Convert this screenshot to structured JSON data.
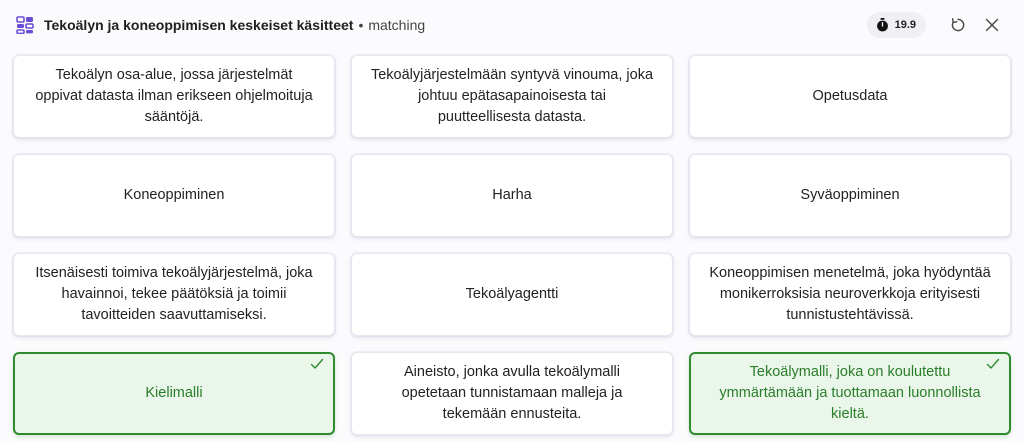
{
  "header": {
    "title": "Tekoälyn ja koneoppimisen keskeiset käsitteet",
    "separator": "•",
    "mode": "matching",
    "timer": "19.9"
  },
  "icons": {
    "app": "app-grid-icon",
    "timer": "stopwatch-icon",
    "restart": "restart-icon",
    "close": "close-icon",
    "check": "checkmark-icon"
  },
  "colors": {
    "matched_border": "#2e8b2e",
    "matched_background": "#eaf6ea",
    "matched_text": "#2a7d2a",
    "app_icon": "#6b4ed8"
  },
  "cards": [
    {
      "text": "Tekoälyn osa-alue, jossa järjestelmät oppivat datasta ilman erikseen ohjelmoituja sääntöjä.",
      "matched": false
    },
    {
      "text": "Tekoälyjärjestelmään syntyvä vinouma, joka johtuu epätasapainoisesta tai puutteellisesta datasta.",
      "matched": false
    },
    {
      "text": "Opetusdata",
      "matched": false
    },
    {
      "text": "Koneoppiminen",
      "matched": false
    },
    {
      "text": "Harha",
      "matched": false
    },
    {
      "text": "Syväoppiminen",
      "matched": false
    },
    {
      "text": "Itsenäisesti toimiva tekoälyjärjestelmä, joka havainnoi, tekee päätöksiä ja toimii tavoitteiden saavuttamiseksi.",
      "matched": false
    },
    {
      "text": "Tekoälyagentti",
      "matched": false
    },
    {
      "text": "Koneoppimisen menetelmä, joka hyödyntää monikerroksisia neuroverkkoja erityisesti tunnistustehtävissä.",
      "matched": false
    },
    {
      "text": "Kielimalli",
      "matched": true
    },
    {
      "text": "Aineisto, jonka avulla tekoälymalli opetetaan tunnistamaan malleja ja tekemään ennusteita.",
      "matched": false
    },
    {
      "text": "Tekoälymalli, joka on koulutettu ymmärtämään ja tuottamaan luonnollista kieltä.",
      "matched": true
    }
  ]
}
